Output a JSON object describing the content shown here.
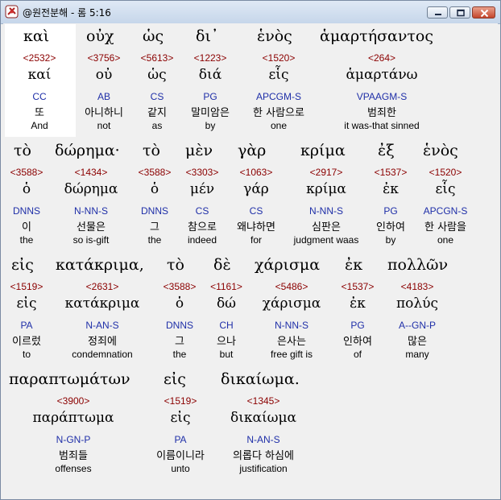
{
  "window": {
    "title": "@원전분해 - 롬 5:16"
  },
  "lines": [
    {
      "words": [
        {
          "greek": "καὶ",
          "strong": "<2532>",
          "lemma": "καί",
          "parse": "CC",
          "korean": "또",
          "english": "And"
        },
        {
          "greek": "οὐχ",
          "strong": "<3756>",
          "lemma": "οὐ",
          "parse": "AB",
          "korean": "아니하니",
          "english": "not"
        },
        {
          "greek": "ὡς",
          "strong": "<5613>",
          "lemma": "ὡς",
          "parse": "CS",
          "korean": "같지",
          "english": "as"
        },
        {
          "greek": "δι᾽",
          "strong": "<1223>",
          "lemma": "διά",
          "parse": "PG",
          "korean": "말미암은",
          "english": "by"
        },
        {
          "greek": "ἑνὸς",
          "strong": "<1520>",
          "lemma": "εἷς",
          "parse": "APCGM-S",
          "korean": "한 사람으로",
          "english": "one"
        },
        {
          "greek": "ἁμαρτήσαντος",
          "strong": "<264>",
          "lemma": "ἁμαρτάνω",
          "parse": "VPAAGM-S",
          "korean": "범죄한",
          "english": "it was-that sinned"
        }
      ]
    },
    {
      "words": [
        {
          "greek": "τὸ",
          "strong": "<3588>",
          "lemma": "ὁ",
          "parse": "DNNS",
          "korean": "이",
          "english": "the"
        },
        {
          "greek": "δώρημα·",
          "strong": "<1434>",
          "lemma": "δώρημα",
          "parse": "N-NN-S",
          "korean": "선물은",
          "english": "so is-gift"
        },
        {
          "greek": "τὸ",
          "strong": "<3588>",
          "lemma": "ὁ",
          "parse": "DNNS",
          "korean": "그",
          "english": "the"
        },
        {
          "greek": "μὲν",
          "strong": "<3303>",
          "lemma": "μέν",
          "parse": "CS",
          "korean": "참으로",
          "english": "indeed"
        },
        {
          "greek": "γὰρ",
          "strong": "<1063>",
          "lemma": "γάρ",
          "parse": "CS",
          "korean": "왜냐하면",
          "english": "for"
        },
        {
          "greek": "κρίμα",
          "strong": "<2917>",
          "lemma": "κρίμα",
          "parse": "N-NN-S",
          "korean": "심판은",
          "english": "judgment waas"
        },
        {
          "greek": "ἐξ",
          "strong": "<1537>",
          "lemma": "ἐκ",
          "parse": "PG",
          "korean": "인하여",
          "english": "by"
        },
        {
          "greek": "ἑνὸς",
          "strong": "<1520>",
          "lemma": "εἷς",
          "parse": "APCGN-S",
          "korean": "한 사람을",
          "english": "one"
        }
      ]
    },
    {
      "words": [
        {
          "greek": "εἰς",
          "strong": "<1519>",
          "lemma": "εἰς",
          "parse": "PA",
          "korean": "이르렀",
          "english": "to"
        },
        {
          "greek": "κατάκριμα,",
          "strong": "<2631>",
          "lemma": "κατάκριμα",
          "parse": "N-AN-S",
          "korean": "정죄에",
          "english": "condemnation"
        },
        {
          "greek": "τὸ",
          "strong": "<3588>",
          "lemma": "ὁ",
          "parse": "DNNS",
          "korean": "그",
          "english": "the"
        },
        {
          "greek": "δὲ",
          "strong": "<1161>",
          "lemma": "δώ",
          "parse": "CH",
          "korean": "으나",
          "english": "but"
        },
        {
          "greek": "χάρισμα",
          "strong": "<5486>",
          "lemma": "χάρισμα",
          "parse": "N-NN-S",
          "korean": "은사는",
          "english": "free gift is"
        },
        {
          "greek": "ἐκ",
          "strong": "<1537>",
          "lemma": "ἐκ",
          "parse": "PG",
          "korean": "인하여",
          "english": "of"
        },
        {
          "greek": "πολλῶν",
          "strong": "<4183>",
          "lemma": "πολύς",
          "parse": "A--GN-P",
          "korean": "많은",
          "english": "many"
        }
      ]
    },
    {
      "words": [
        {
          "greek": "παραπτωμάτων",
          "strong": "<3900>",
          "lemma": "παράπτωμα",
          "parse": "N-GN-P",
          "korean": "범죄들",
          "english": "offenses"
        },
        {
          "greek": "εἰς",
          "strong": "<1519>",
          "lemma": "εἰς",
          "parse": "PA",
          "korean": "이름이니라",
          "english": "unto"
        },
        {
          "greek": "δικαίωμα.",
          "strong": "<1345>",
          "lemma": "δικαίωμα",
          "parse": "N-AN-S",
          "korean": "의롭다 하심에",
          "english": "justification"
        }
      ]
    }
  ]
}
